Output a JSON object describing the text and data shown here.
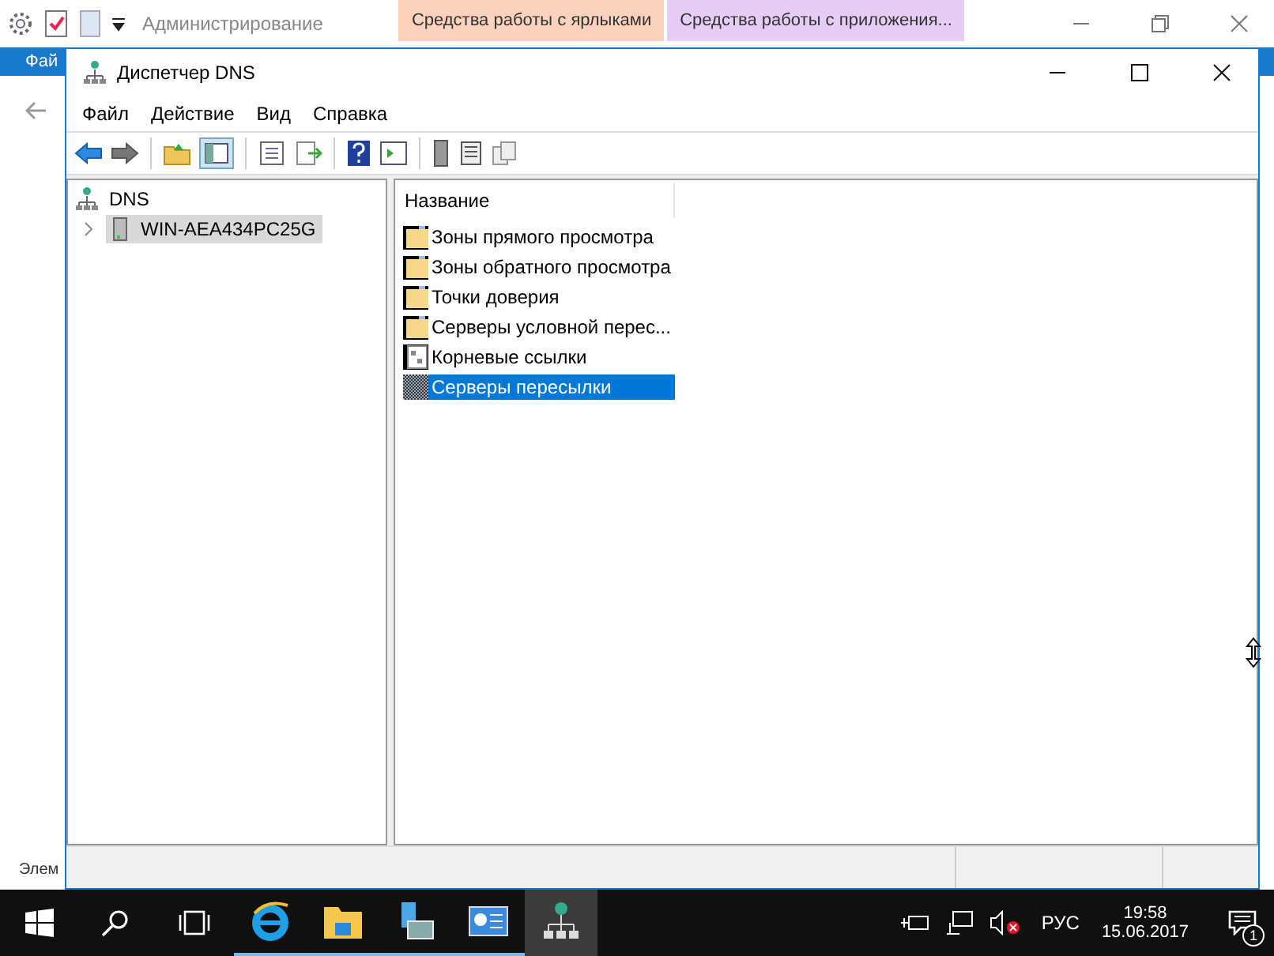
{
  "background_window": {
    "title": "Администрирование",
    "context_tabs": [
      {
        "label": "Средства работы с ярлыками",
        "color": "#fad2be"
      },
      {
        "label": "Средства работы с приложения...",
        "color": "#e6cdf5"
      }
    ],
    "file_tab": "Фай",
    "status_text": "Элем"
  },
  "window": {
    "title": "Диспетчер DNS"
  },
  "menu": [
    "Файл",
    "Действие",
    "Вид",
    "Справка"
  ],
  "tree": {
    "label": "DNS",
    "children": [
      {
        "label": "WIN-AEA434PC25G",
        "expanded": false,
        "selected": true
      }
    ]
  },
  "list": {
    "column": "Название",
    "items": [
      {
        "label": "Зоны прямого просмотра",
        "kind": "folder",
        "selected": false
      },
      {
        "label": "Зоны обратного просмотра",
        "kind": "folder",
        "selected": false
      },
      {
        "label": "Точки доверия",
        "kind": "folder",
        "selected": false
      },
      {
        "label": "Серверы условной перес...",
        "kind": "folder",
        "selected": false
      },
      {
        "label": "Корневые ссылки",
        "kind": "binary",
        "selected": false
      },
      {
        "label": "Серверы пересылки",
        "kind": "grid",
        "selected": true
      }
    ]
  },
  "taskbar": {
    "apps": [
      {
        "kind": "ie",
        "active": false
      },
      {
        "kind": "explorer",
        "active": false
      },
      {
        "kind": "server",
        "active": false
      },
      {
        "kind": "panel",
        "active": false
      },
      {
        "kind": "dns",
        "active": true
      }
    ],
    "language": "РУС",
    "time": "19:58",
    "date": "15.06.2017",
    "notifications": "1"
  }
}
